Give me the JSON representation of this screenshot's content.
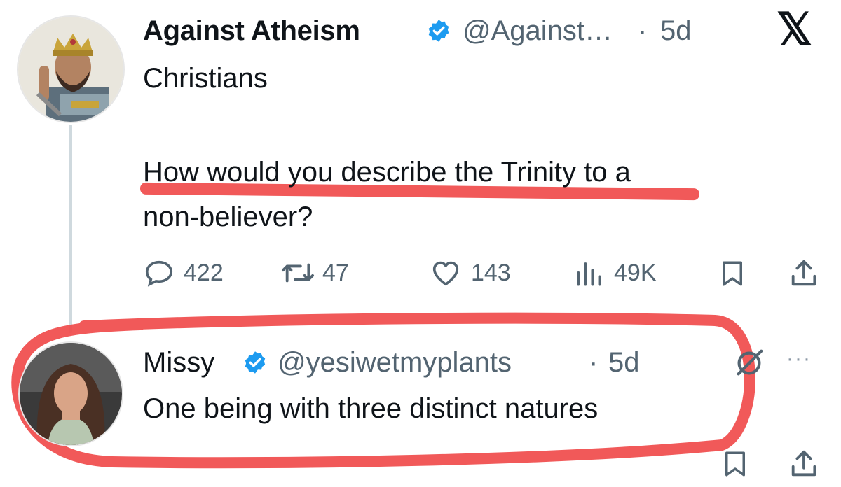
{
  "tweet": {
    "author_name": "Against Atheism",
    "handle": "@Against…",
    "separator": "·",
    "time": "5d",
    "line1": "Christians",
    "line2": "How would you describe the Trinity to a",
    "line3": "non-believer?",
    "metrics": {
      "replies": "422",
      "reposts": "47",
      "likes": "143",
      "views": "49K"
    }
  },
  "reply": {
    "author_name": "Missy",
    "handle": "@yesiwetmyplants",
    "separator": "·",
    "time": "5d",
    "text": "One being with three distinct natures",
    "more": "···"
  },
  "brand_logo": "𝕏",
  "colors": {
    "verified_blue": "#1d9bf0",
    "highlight_red": "#f04b4b",
    "muted": "#536471"
  },
  "icons": [
    "x-logo-icon",
    "verified-badge-icon",
    "reply-icon",
    "repost-icon",
    "like-icon",
    "views-icon",
    "bookmark-icon",
    "share-icon",
    "grok-icon",
    "more-icon"
  ]
}
